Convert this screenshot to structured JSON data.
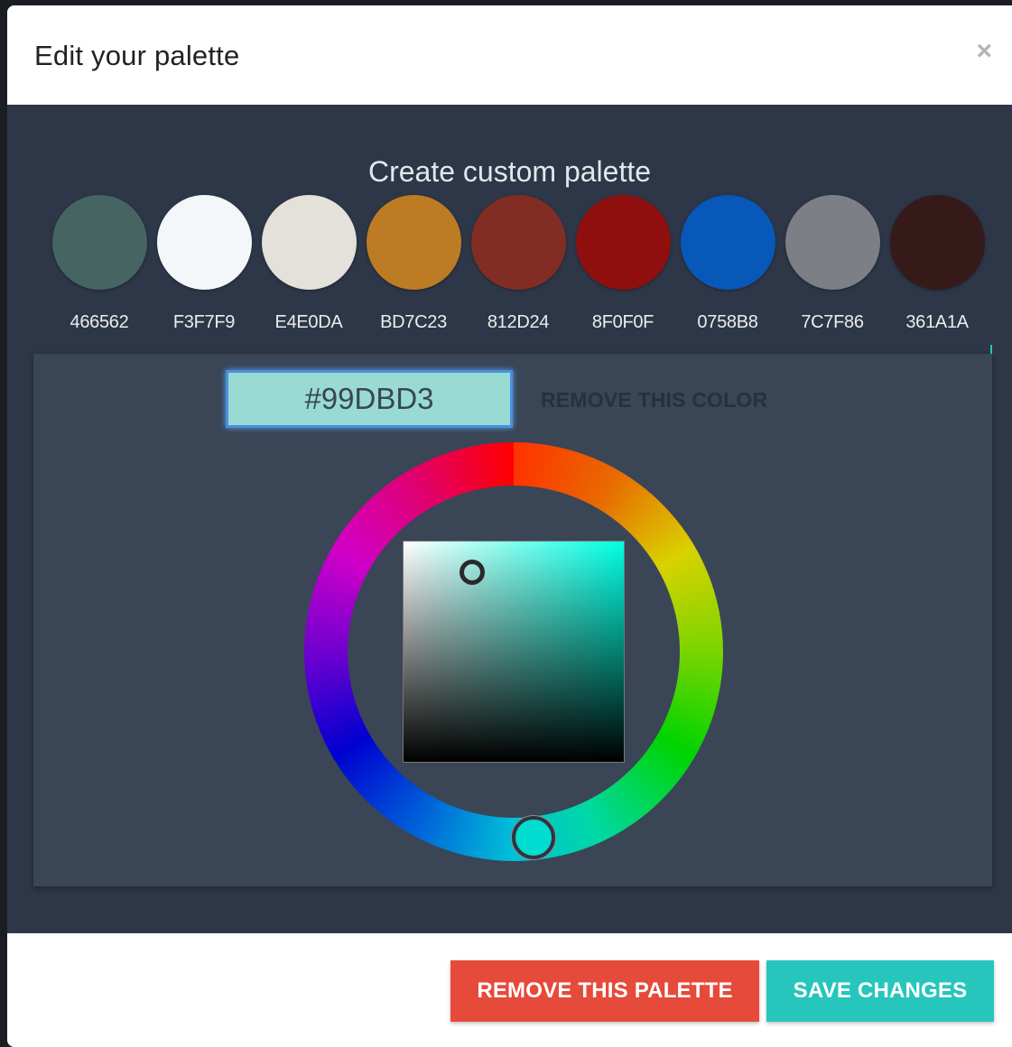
{
  "modal": {
    "title": "Edit your palette",
    "close_symbol": "×"
  },
  "palette_editor": {
    "heading": "Create custom palette",
    "swatches": [
      {
        "hex": "466562",
        "color": "#466562"
      },
      {
        "hex": "F3F7F9",
        "color": "#F3F7F9"
      },
      {
        "hex": "E4E0DA",
        "color": "#E4E0DA"
      },
      {
        "hex": "BD7C23",
        "color": "#BD7C23"
      },
      {
        "hex": "812D24",
        "color": "#812D24"
      },
      {
        "hex": "8F0F0F",
        "color": "#8F0F0F"
      },
      {
        "hex": "0758B8",
        "color": "#0758B8"
      },
      {
        "hex": "7C7F86",
        "color": "#7C7F86"
      },
      {
        "hex": "361A1A",
        "color": "#361A1A"
      }
    ]
  },
  "color_picker": {
    "hex_value": "#99DBD3",
    "remove_color_label": "REMOVE THIS COLOR",
    "current_color": "#99DBD3"
  },
  "footer": {
    "remove_palette_label": "REMOVE THIS PALETTE",
    "save_label": "SAVE CHANGES"
  },
  "colors": {
    "body_bg": "#2d3748",
    "panel_bg": "#3a4556",
    "danger": "#e64a3b",
    "accent": "#26c6bc"
  }
}
